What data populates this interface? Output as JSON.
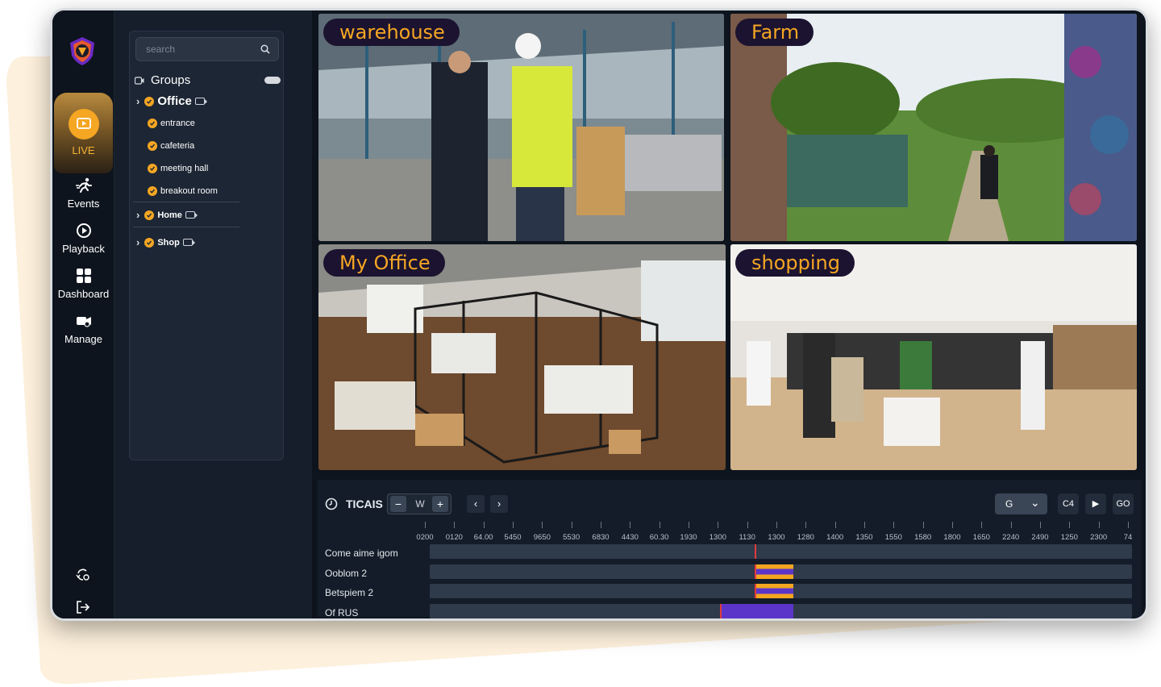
{
  "sidebar": {
    "items": [
      {
        "label": "LIVE",
        "icon": "play-screen-icon",
        "active": true
      },
      {
        "label": "Events",
        "icon": "running-person-icon"
      },
      {
        "label": "Playback",
        "icon": "playback-icon"
      },
      {
        "label": "Dashboard",
        "icon": "grid-icon"
      },
      {
        "label": "Manage",
        "icon": "camera-settings-icon"
      }
    ],
    "bottom_icons": [
      "sync-settings-icon",
      "logout-icon"
    ]
  },
  "tree": {
    "search_placeholder": "search",
    "groups_label": "Groups",
    "nodes": [
      {
        "label": "Office",
        "children": [
          "entrance",
          "cafeteria",
          "meeting hall",
          "breakout room"
        ]
      },
      {
        "label": "Home"
      },
      {
        "label": "Shop"
      }
    ]
  },
  "cameras": [
    {
      "label": "warehouse"
    },
    {
      "label": "Farm"
    },
    {
      "label": "My Office"
    },
    {
      "label": "shopping"
    }
  ],
  "timeline": {
    "title": "TICAIS",
    "zoom_minus": "−",
    "zoom_value": "W",
    "zoom_plus": "+",
    "prev": "‹",
    "next": "›",
    "select_value": "G",
    "select_caret": "⌄",
    "btn_a": "C4",
    "btn_b": "▶",
    "btn_c": "GO",
    "ticks": [
      "0200",
      "0120",
      "64.00",
      "5450",
      "9650",
      "5530",
      "6830",
      "4430",
      "60.30",
      "1930",
      "1300",
      "1130",
      "1300",
      "1280",
      "1400",
      "1350",
      "1550",
      "1580",
      "1800",
      "1650",
      "2240",
      "2490",
      "1250",
      "2300",
      "74"
    ],
    "tracks": [
      {
        "name": "Come aime igom"
      },
      {
        "name": "Ooblom 2"
      },
      {
        "name": "Betspiem 2"
      },
      {
        "name": "Of RUS"
      }
    ],
    "colors": {
      "recording": "#f2a61f",
      "motion": "#5b35c9",
      "marker": "#e23b3b"
    }
  }
}
